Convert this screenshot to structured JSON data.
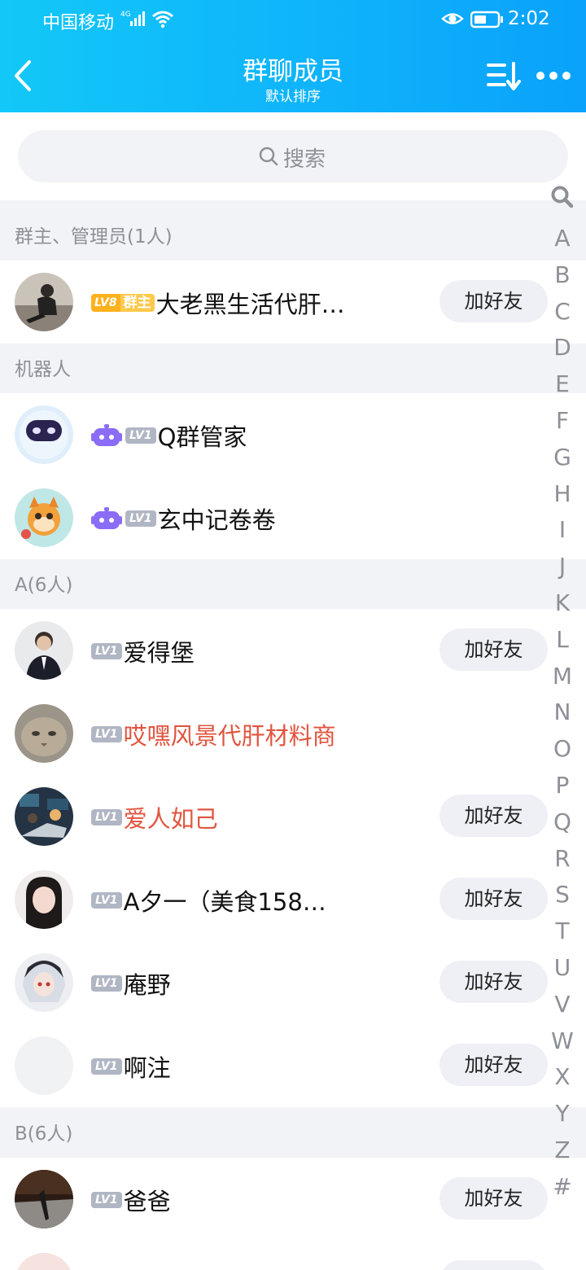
{
  "status_bar": {
    "carrier": "中国移动",
    "network": "4G",
    "time": "2:02"
  },
  "header": {
    "title": "群聊成员",
    "subtitle": "默认排序"
  },
  "search": {
    "placeholder": "搜索"
  },
  "sections": [
    {
      "label": "群主、管理员(1人)"
    },
    {
      "label": "机器人"
    },
    {
      "label": "A(6人)"
    },
    {
      "label": "B(6人)"
    }
  ],
  "members": [
    {
      "name": "大老黑生活代肝…",
      "level": "LV8",
      "role": "群主",
      "add_label": "加好友"
    },
    {
      "name": "Q群管家",
      "level": "LV1"
    },
    {
      "name": "玄中记卷卷",
      "level": "LV1"
    },
    {
      "name": "爱得堡",
      "level": "LV1",
      "add_label": "加好友"
    },
    {
      "name": "哎嘿风景代肝材料商",
      "level": "LV1"
    },
    {
      "name": "爱人如己",
      "level": "LV1",
      "add_label": "加好友"
    },
    {
      "name": "A夕一（美食158…",
      "level": "LV1",
      "add_label": "加好友"
    },
    {
      "name": "庵野",
      "level": "LV1",
      "add_label": "加好友"
    },
    {
      "name": "啊注",
      "level": "LV1",
      "add_label": "加好友"
    },
    {
      "name": "爸爸",
      "level": "LV1",
      "add_label": "加好友"
    }
  ],
  "index_letters": [
    "A",
    "B",
    "C",
    "D",
    "E",
    "F",
    "G",
    "H",
    "I",
    "J",
    "K",
    "L",
    "M",
    "N",
    "O",
    "P",
    "Q",
    "R",
    "S",
    "T",
    "U",
    "V",
    "W",
    "X",
    "Y",
    "Z",
    "#"
  ],
  "colors": {
    "header_start": "#12c8f8",
    "header_end": "#0aa2fb",
    "highlight_name": "#e0553f",
    "owner_badge": "#ffb11e",
    "robot_icon": "#8b6cf6"
  }
}
